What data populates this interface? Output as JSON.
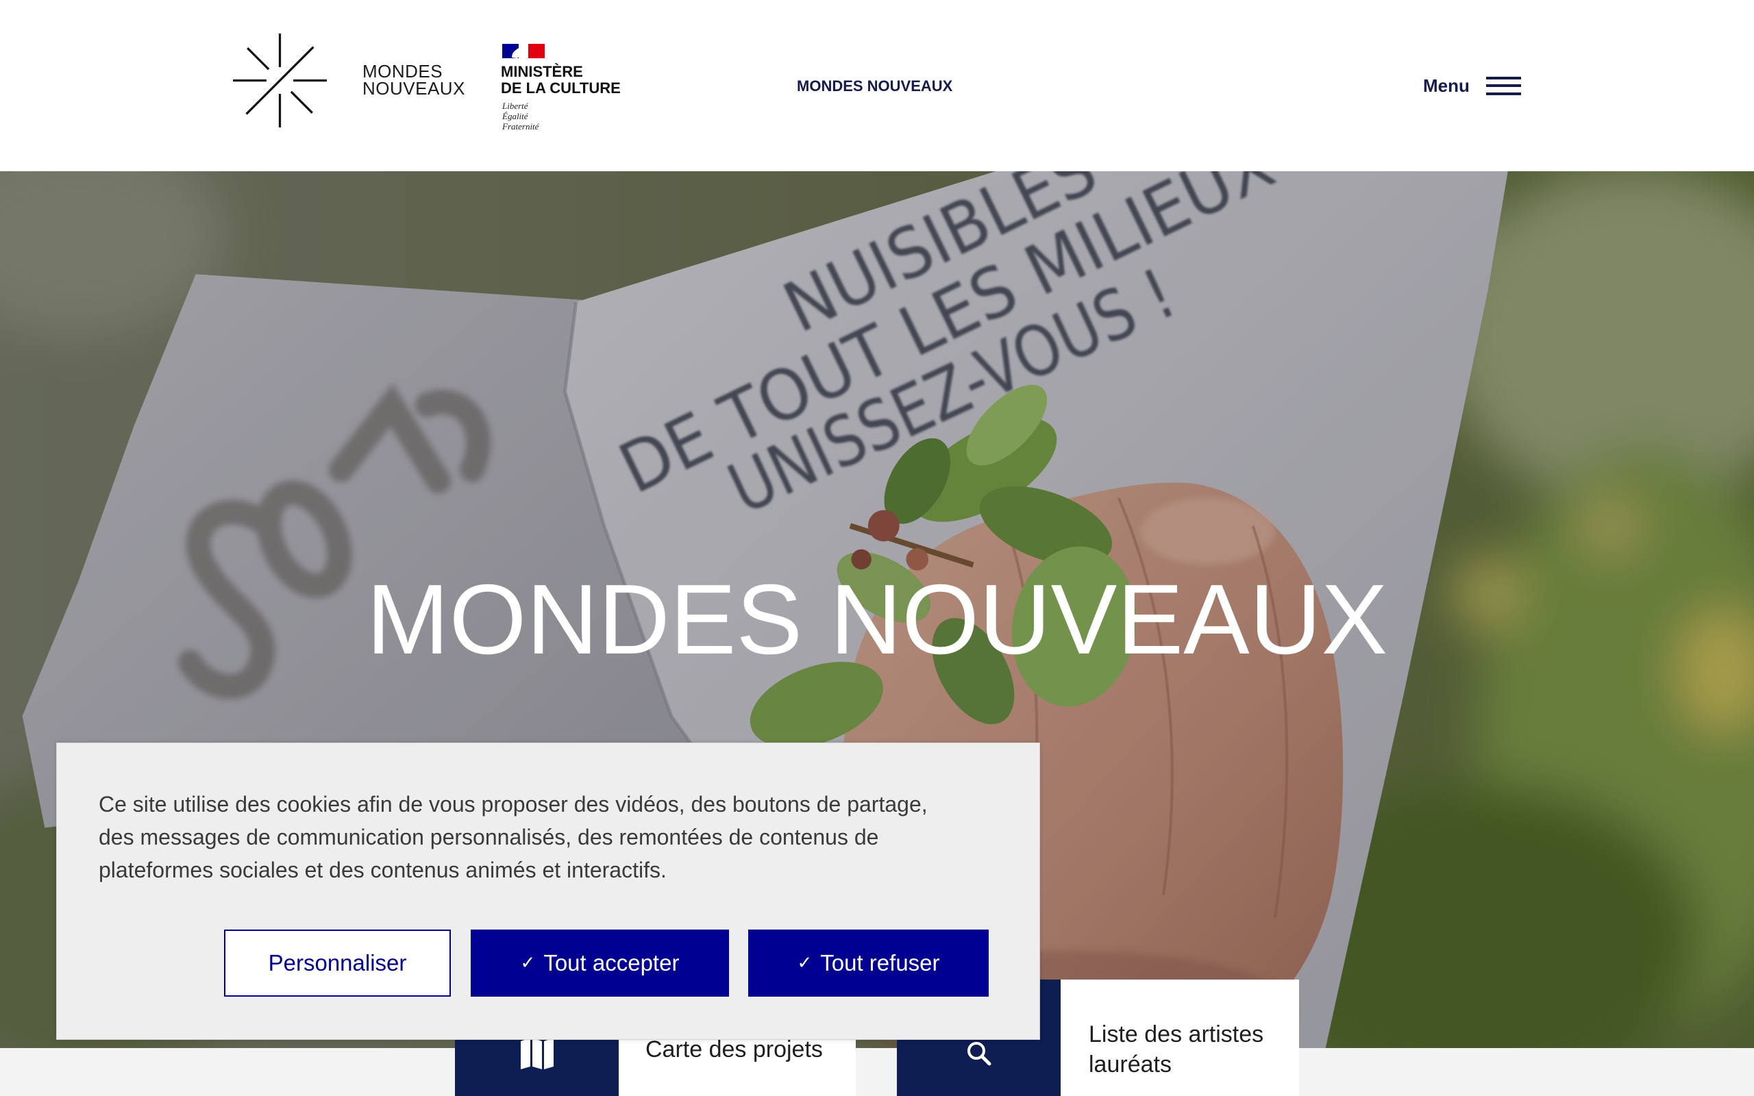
{
  "header": {
    "logo": {
      "icon": "star-burst-icon",
      "line1": "MONDES",
      "line2": "NOUVEAUX"
    },
    "ministry": {
      "flag_icon": "french-republic-flag-icon",
      "line1": "MINISTÈRE",
      "line2": "DE LA CULTURE",
      "motto": [
        "Liberté",
        "Égalité",
        "Fraternité"
      ]
    },
    "nav_title": "MONDES NOUVEAUX",
    "menu": {
      "label": "Menu",
      "icon": "hamburger-icon"
    }
  },
  "hero": {
    "title": "MONDES NOUVEAUX",
    "photo_lettering": [
      "NUISIBLES",
      "DE TOUT LES MILIEUX",
      "UNISSEZ-VOUS !"
    ]
  },
  "quick_links": [
    {
      "label": "Carte des projets",
      "icon": "map-icon"
    },
    {
      "label": "Liste des artistes lauréats",
      "icon": "search-icon"
    }
  ],
  "cookie_banner": {
    "message_lines": [
      "Ce site utilise des cookies afin de vous proposer des vidéos, des boutons de partage,",
      "des messages de communication personnalisés, des remontées de contenus de",
      "plateformes sociales et des contenus animés et interactifs."
    ],
    "check_icon": "✓",
    "buttons": {
      "customize": "Personnaliser",
      "accept_all": "Tout accepter",
      "refuse_all": "Tout refuser"
    }
  },
  "colors": {
    "primary_blue": "#000091",
    "navy": "#0e1d52",
    "nav_text": "#161b4d",
    "banner_bg": "#eeeeee",
    "flag_blue": "#000091",
    "flag_red": "#e1000f"
  }
}
